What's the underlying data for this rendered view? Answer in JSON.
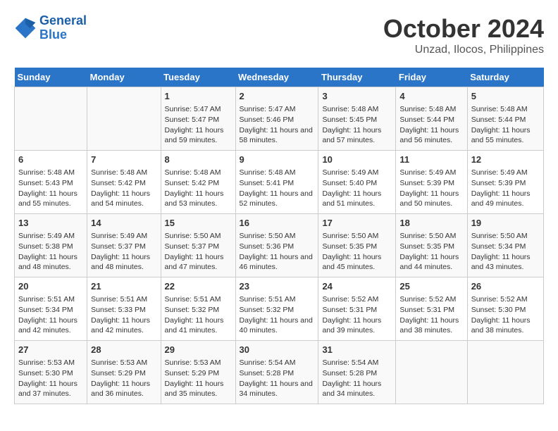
{
  "logo": {
    "line1": "General",
    "line2": "Blue"
  },
  "title": "October 2024",
  "subtitle": "Unzad, Ilocos, Philippines",
  "days_of_week": [
    "Sunday",
    "Monday",
    "Tuesday",
    "Wednesday",
    "Thursday",
    "Friday",
    "Saturday"
  ],
  "weeks": [
    [
      {
        "day": "",
        "content": ""
      },
      {
        "day": "",
        "content": ""
      },
      {
        "day": "1",
        "content": "Sunrise: 5:47 AM\nSunset: 5:47 PM\nDaylight: 11 hours and 59 minutes."
      },
      {
        "day": "2",
        "content": "Sunrise: 5:47 AM\nSunset: 5:46 PM\nDaylight: 11 hours and 58 minutes."
      },
      {
        "day": "3",
        "content": "Sunrise: 5:48 AM\nSunset: 5:45 PM\nDaylight: 11 hours and 57 minutes."
      },
      {
        "day": "4",
        "content": "Sunrise: 5:48 AM\nSunset: 5:44 PM\nDaylight: 11 hours and 56 minutes."
      },
      {
        "day": "5",
        "content": "Sunrise: 5:48 AM\nSunset: 5:44 PM\nDaylight: 11 hours and 55 minutes."
      }
    ],
    [
      {
        "day": "6",
        "content": "Sunrise: 5:48 AM\nSunset: 5:43 PM\nDaylight: 11 hours and 55 minutes."
      },
      {
        "day": "7",
        "content": "Sunrise: 5:48 AM\nSunset: 5:42 PM\nDaylight: 11 hours and 54 minutes."
      },
      {
        "day": "8",
        "content": "Sunrise: 5:48 AM\nSunset: 5:42 PM\nDaylight: 11 hours and 53 minutes."
      },
      {
        "day": "9",
        "content": "Sunrise: 5:48 AM\nSunset: 5:41 PM\nDaylight: 11 hours and 52 minutes."
      },
      {
        "day": "10",
        "content": "Sunrise: 5:49 AM\nSunset: 5:40 PM\nDaylight: 11 hours and 51 minutes."
      },
      {
        "day": "11",
        "content": "Sunrise: 5:49 AM\nSunset: 5:39 PM\nDaylight: 11 hours and 50 minutes."
      },
      {
        "day": "12",
        "content": "Sunrise: 5:49 AM\nSunset: 5:39 PM\nDaylight: 11 hours and 49 minutes."
      }
    ],
    [
      {
        "day": "13",
        "content": "Sunrise: 5:49 AM\nSunset: 5:38 PM\nDaylight: 11 hours and 48 minutes."
      },
      {
        "day": "14",
        "content": "Sunrise: 5:49 AM\nSunset: 5:37 PM\nDaylight: 11 hours and 48 minutes."
      },
      {
        "day": "15",
        "content": "Sunrise: 5:50 AM\nSunset: 5:37 PM\nDaylight: 11 hours and 47 minutes."
      },
      {
        "day": "16",
        "content": "Sunrise: 5:50 AM\nSunset: 5:36 PM\nDaylight: 11 hours and 46 minutes."
      },
      {
        "day": "17",
        "content": "Sunrise: 5:50 AM\nSunset: 5:35 PM\nDaylight: 11 hours and 45 minutes."
      },
      {
        "day": "18",
        "content": "Sunrise: 5:50 AM\nSunset: 5:35 PM\nDaylight: 11 hours and 44 minutes."
      },
      {
        "day": "19",
        "content": "Sunrise: 5:50 AM\nSunset: 5:34 PM\nDaylight: 11 hours and 43 minutes."
      }
    ],
    [
      {
        "day": "20",
        "content": "Sunrise: 5:51 AM\nSunset: 5:34 PM\nDaylight: 11 hours and 42 minutes."
      },
      {
        "day": "21",
        "content": "Sunrise: 5:51 AM\nSunset: 5:33 PM\nDaylight: 11 hours and 42 minutes."
      },
      {
        "day": "22",
        "content": "Sunrise: 5:51 AM\nSunset: 5:32 PM\nDaylight: 11 hours and 41 minutes."
      },
      {
        "day": "23",
        "content": "Sunrise: 5:51 AM\nSunset: 5:32 PM\nDaylight: 11 hours and 40 minutes."
      },
      {
        "day": "24",
        "content": "Sunrise: 5:52 AM\nSunset: 5:31 PM\nDaylight: 11 hours and 39 minutes."
      },
      {
        "day": "25",
        "content": "Sunrise: 5:52 AM\nSunset: 5:31 PM\nDaylight: 11 hours and 38 minutes."
      },
      {
        "day": "26",
        "content": "Sunrise: 5:52 AM\nSunset: 5:30 PM\nDaylight: 11 hours and 38 minutes."
      }
    ],
    [
      {
        "day": "27",
        "content": "Sunrise: 5:53 AM\nSunset: 5:30 PM\nDaylight: 11 hours and 37 minutes."
      },
      {
        "day": "28",
        "content": "Sunrise: 5:53 AM\nSunset: 5:29 PM\nDaylight: 11 hours and 36 minutes."
      },
      {
        "day": "29",
        "content": "Sunrise: 5:53 AM\nSunset: 5:29 PM\nDaylight: 11 hours and 35 minutes."
      },
      {
        "day": "30",
        "content": "Sunrise: 5:54 AM\nSunset: 5:28 PM\nDaylight: 11 hours and 34 minutes."
      },
      {
        "day": "31",
        "content": "Sunrise: 5:54 AM\nSunset: 5:28 PM\nDaylight: 11 hours and 34 minutes."
      },
      {
        "day": "",
        "content": ""
      },
      {
        "day": "",
        "content": ""
      }
    ]
  ]
}
